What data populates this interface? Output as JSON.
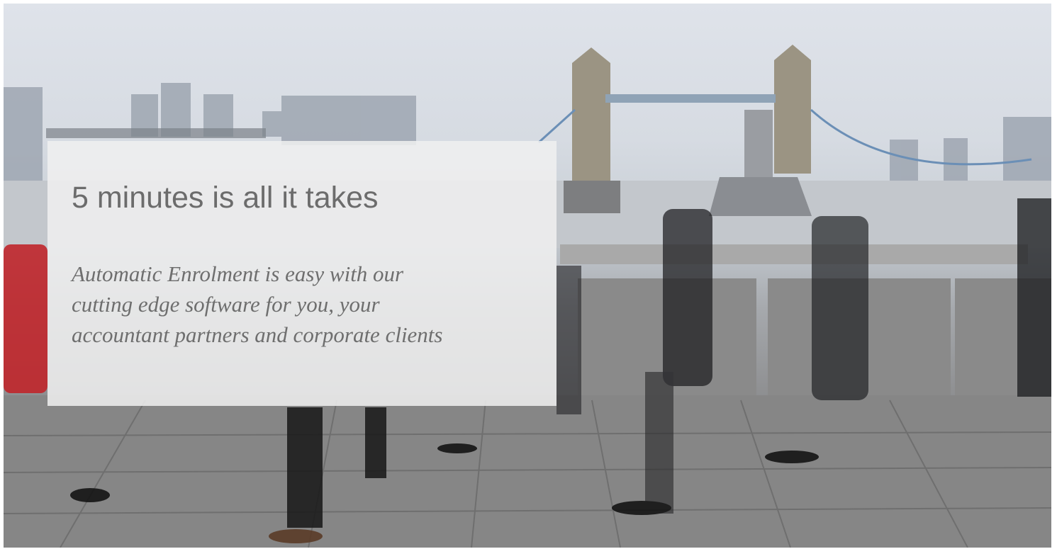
{
  "hero": {
    "headline": "5 minutes is all it takes",
    "tagline_lines": [
      "Automatic Enrolment is easy with our",
      "cutting edge software for you, your",
      "accountant partners and corporate clients"
    ],
    "image_description_icon": "city-bridge-photo"
  },
  "colors": {
    "card_background": "#f0f0f0",
    "headline_text": "#6c6c6c",
    "tagline_text": "#6e6e6e"
  }
}
